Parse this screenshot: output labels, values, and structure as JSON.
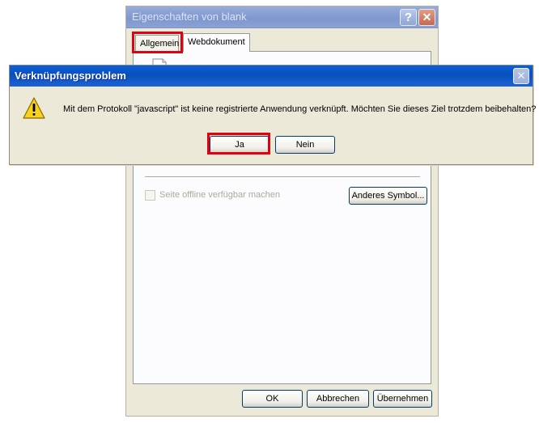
{
  "properties_window": {
    "title": "Eigenschaften von blank",
    "help_button_label": "?",
    "close_button_label": "✕",
    "tabs": [
      {
        "label": "Allgemein",
        "active": false
      },
      {
        "label": "Webdokument",
        "active": true
      }
    ],
    "offline_checkbox_label": "Seite offline verfügbar machen",
    "change_icon_button": "Anderes Symbol...",
    "ok_button": "OK",
    "cancel_button": "Abbrechen",
    "apply_button": "Übernehmen"
  },
  "dialog": {
    "title": "Verknüpfungsproblem",
    "close_button_label": "✕",
    "message": "Mit dem Protokoll \"javascript\" ist keine registrierte Anwendung verknüpft. Möchten Sie dieses Ziel trotzdem beibehalten?",
    "yes_button": "Ja",
    "no_button": "Nein"
  },
  "colors": {
    "highlight": "#e3000f",
    "dialog_titlebar": "#0b4fbd",
    "inactive_titlebar": "#7e97cf",
    "dialog_face": "#ece9d8"
  },
  "icons": {
    "dialog_icon": "warning-icon",
    "document_icon": "document-icon"
  }
}
